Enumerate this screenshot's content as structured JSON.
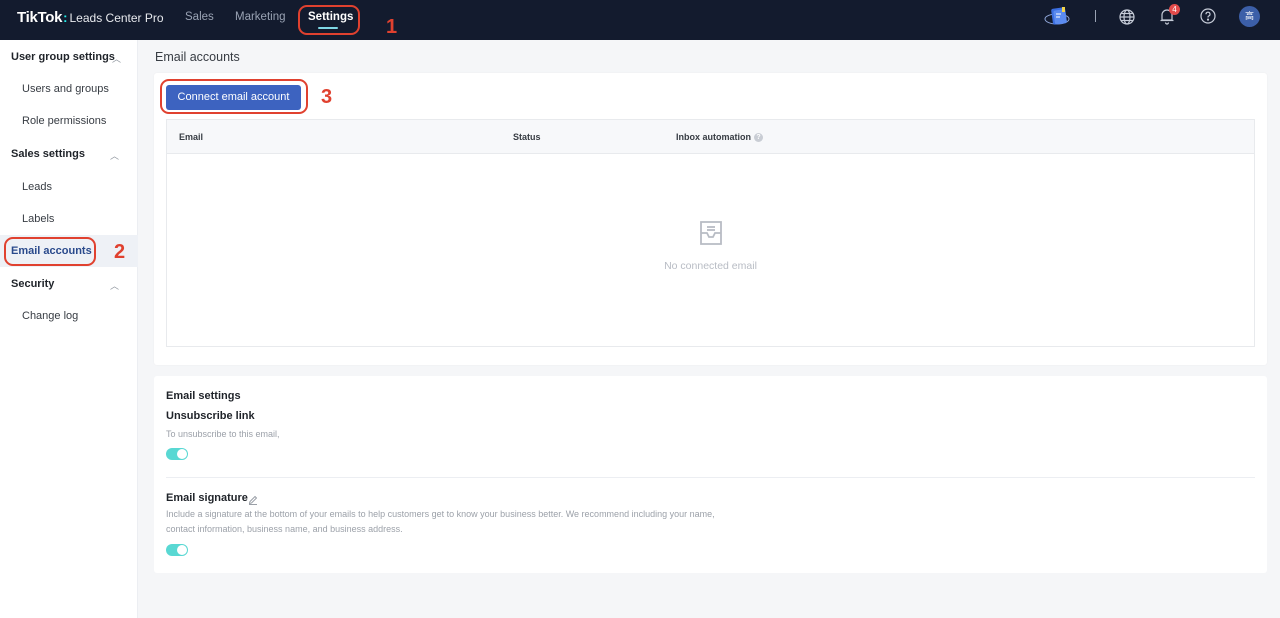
{
  "app": {
    "brand": "TikTok",
    "product": "Leads Center Pro"
  },
  "topnav": {
    "items": [
      {
        "label": "Sales",
        "active": false
      },
      {
        "label": "Marketing",
        "active": false
      },
      {
        "label": "Settings",
        "active": true
      }
    ],
    "icons": [
      "promo-book-icon",
      "globe-icon",
      "bell-icon",
      "help-icon"
    ],
    "notification_count": "4",
    "avatar_initial": "高"
  },
  "annotations": [
    "1",
    "2",
    "3"
  ],
  "sidebar": {
    "groups": [
      {
        "label": "User group settings",
        "items": [
          "Users and groups",
          "Role permissions"
        ]
      },
      {
        "label": "Sales settings",
        "items": [
          "Leads",
          "Labels"
        ]
      },
      {
        "label": "Email accounts",
        "items": [],
        "active": true
      },
      {
        "label": "Security",
        "items": [
          "Change log"
        ]
      }
    ]
  },
  "main": {
    "title": "Email accounts",
    "connect_button": "Connect email account",
    "table": {
      "columns": [
        "Email",
        "Status",
        "Inbox automation"
      ],
      "empty_text": "No connected email"
    },
    "email_settings": {
      "title": "Email settings",
      "unsubscribe": {
        "title": "Unsubscribe link",
        "description": "To unsubscribe to this email,",
        "enabled": true
      },
      "signature": {
        "title": "Email signature",
        "description": "Include a signature at the bottom of your emails to help customers get to know your business better. We recommend including your name, contact information, business name, and business address.",
        "enabled": true
      }
    }
  },
  "colors": {
    "topbar": "#131b2e",
    "primary": "#3d63c0",
    "toggle_on": "#59d8d3",
    "annotation": "#e0412f"
  }
}
